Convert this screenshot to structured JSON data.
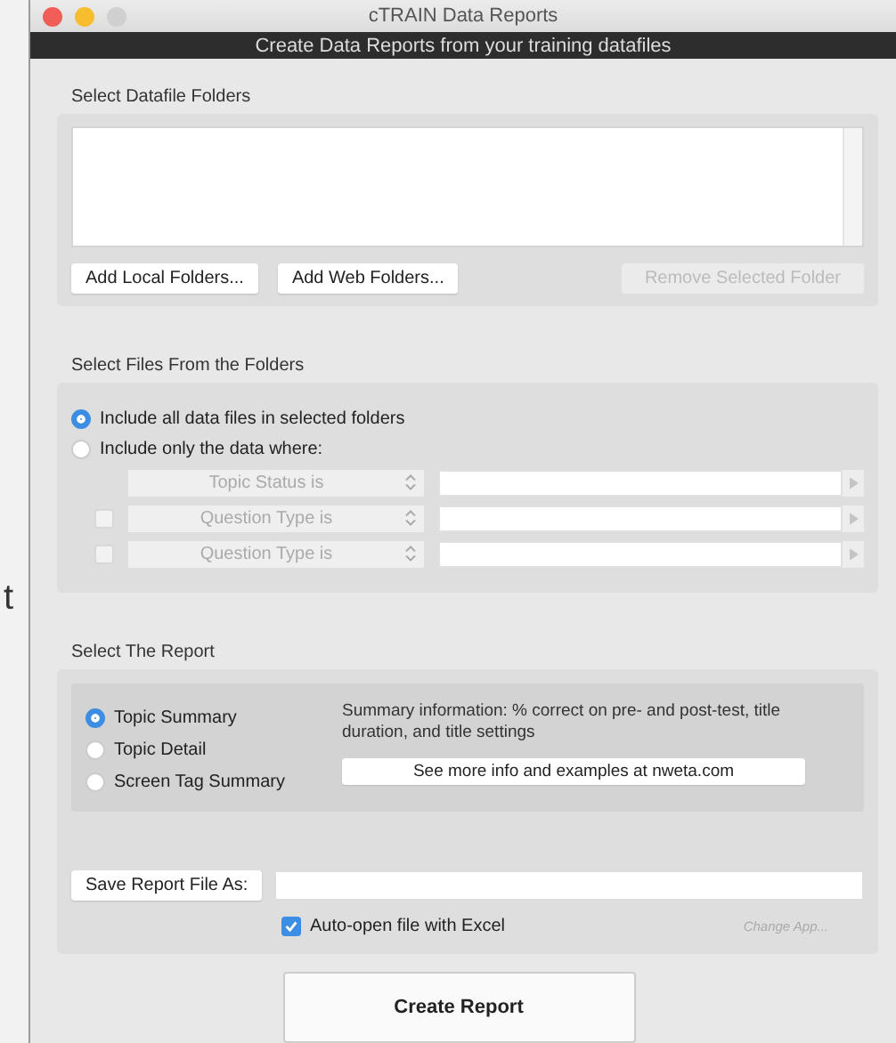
{
  "background_text": "t",
  "window": {
    "title": "cTRAIN Data Reports"
  },
  "header": {
    "subtitle": "Create Data Reports from your training datafiles"
  },
  "folders": {
    "label": "Select Datafile Folders",
    "buttons": [
      {
        "label": "Add Local Folders...",
        "disabled": false
      },
      {
        "label": "Add Web Folders...",
        "disabled": false
      },
      {
        "label": "Remove Selected Folder",
        "disabled": true
      }
    ]
  },
  "files": {
    "label": "Select Files From the Folders",
    "options": [
      {
        "label": "Include all data files in selected folders",
        "selected": true
      },
      {
        "label": "Include only the data where:",
        "selected": false
      }
    ],
    "conditions": [
      {
        "kind": "plain",
        "field": "Topic Status is",
        "disabled": true
      },
      {
        "kind": "checkbox",
        "field": "Question Type is",
        "checked": false,
        "disabled": true
      },
      {
        "kind": "checkbox",
        "field": "Question Type is",
        "checked": false,
        "disabled": true
      }
    ]
  },
  "report": {
    "label": "Select The Report",
    "types": [
      {
        "label": "Topic Summary",
        "selected": true
      },
      {
        "label": "Topic Detail",
        "selected": false
      },
      {
        "label": "Screen Tag Summary",
        "selected": false
      }
    ],
    "description": "Summary information: % correct on pre- and post-test, title duration, and title settings",
    "info_button": "See more info and examples at nweta.com",
    "save_button": "Save Report File As:",
    "auto_open": {
      "label": "Auto-open file with Excel",
      "checked": true
    },
    "change_app": {
      "label": "Change App...",
      "disabled": true
    }
  },
  "create_button": "Create Report"
}
